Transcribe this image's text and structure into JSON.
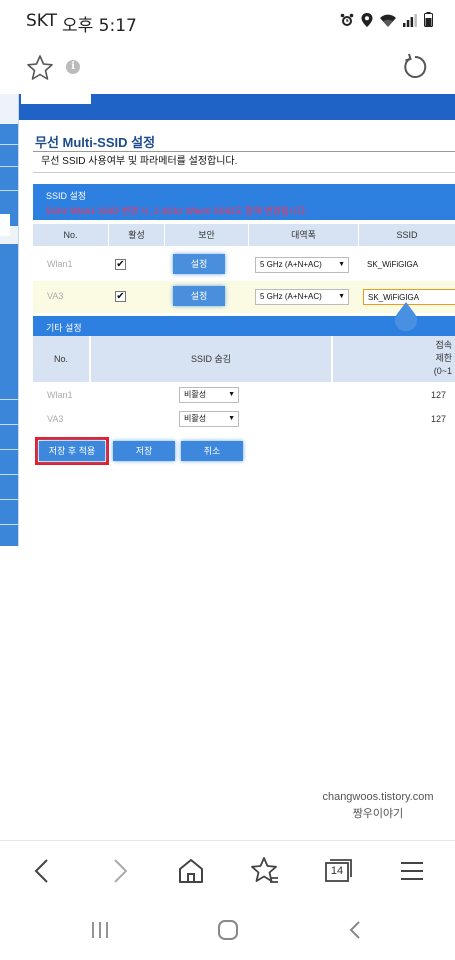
{
  "status_bar": {
    "carrier": "SKT",
    "time": "오후 5:17",
    "icons": [
      "alarm-icon",
      "location-icon",
      "wifi-icon",
      "signal-icon",
      "battery-icon"
    ]
  },
  "browser": {
    "icons": [
      "star-icon",
      "info-icon",
      "reload-icon"
    ],
    "nav": {
      "tabs_count": "14",
      "icons": [
        "back-icon",
        "forward-icon",
        "home-icon",
        "bookmarks-icon",
        "tabs-icon",
        "menu-icon"
      ]
    }
  },
  "page": {
    "title": "무선 Multi-SSID 설정",
    "subtitle": "무선 SSID 사용여부 및 파라메터를 설정합니다.",
    "ssid_section": {
      "title": "SSID 설정",
      "warning": "5Ghz Wlan1 SSID 변경 시, 2.4Ghz Wlan0 SSID도 함께 변경됩니다.",
      "columns": [
        "No.",
        "활성",
        "보안",
        "대역폭",
        "SSID"
      ],
      "rows": [
        {
          "no": "Wlan1",
          "active": true,
          "security_btn": "설정",
          "bandwidth": "5 GHz (A+N+AC)",
          "ssid": "SK_WiFiGIGA"
        },
        {
          "no": "VA3",
          "active": true,
          "security_btn": "설정",
          "bandwidth": "5 GHz (A+N+AC)",
          "ssid": "SK_WiFiGIGA"
        }
      ]
    },
    "other_section": {
      "title": "기타 설정",
      "columns": [
        "No.",
        "SSID 숨김",
        "접속\n제한\n(0~1"
      ],
      "rows": [
        {
          "no": "Wlan1",
          "hide": "비활성",
          "limit": "127"
        },
        {
          "no": "VA3",
          "hide": "비활성",
          "limit": "127"
        }
      ]
    },
    "buttons": {
      "save_apply": "저장 후 적용",
      "save": "저장",
      "cancel": "취소"
    },
    "colors": {
      "header_blue": "#2d7fe0",
      "warning_red": "#ff3355",
      "highlight_red": "#e51d2a"
    }
  },
  "watermark": {
    "line1": "changwoos.tistory.com",
    "line2": "짱우이야기"
  }
}
